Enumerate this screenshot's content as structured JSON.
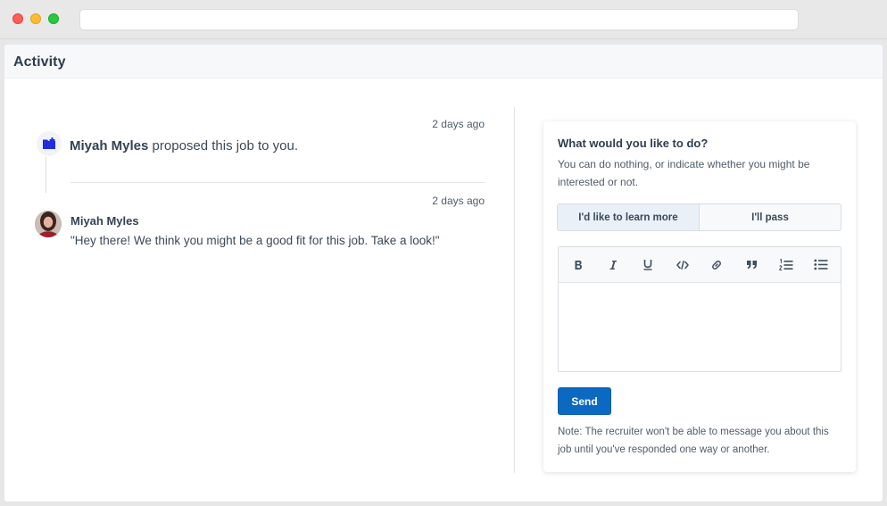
{
  "header": {
    "title": "Activity"
  },
  "activity": {
    "items": [
      {
        "time": "2 days ago",
        "actor": "Miyah Myles",
        "action": "proposed this job to you.",
        "icon": "folder-add-icon"
      },
      {
        "time": "2 days ago",
        "author": "Miyah Myles",
        "message": "\"Hey there! We think you might be a good fit for this job. Take a look!\""
      }
    ]
  },
  "card": {
    "title": "What would you like to do?",
    "subtitle": "You can do nothing, or indicate whether you might be interested or not.",
    "options": [
      "I'd like to learn more",
      "I'll pass"
    ],
    "toolbar": [
      "bold-icon",
      "italic-icon",
      "underline-icon",
      "code-icon",
      "link-icon",
      "quote-icon",
      "ordered-list-icon",
      "bullet-list-icon"
    ],
    "send_label": "Send",
    "note": "Note: The recruiter won't be able to message you about this job until you've responded one way or another."
  },
  "colors": {
    "accent": "#0c69c2",
    "icon_blue": "#1f2de0"
  }
}
